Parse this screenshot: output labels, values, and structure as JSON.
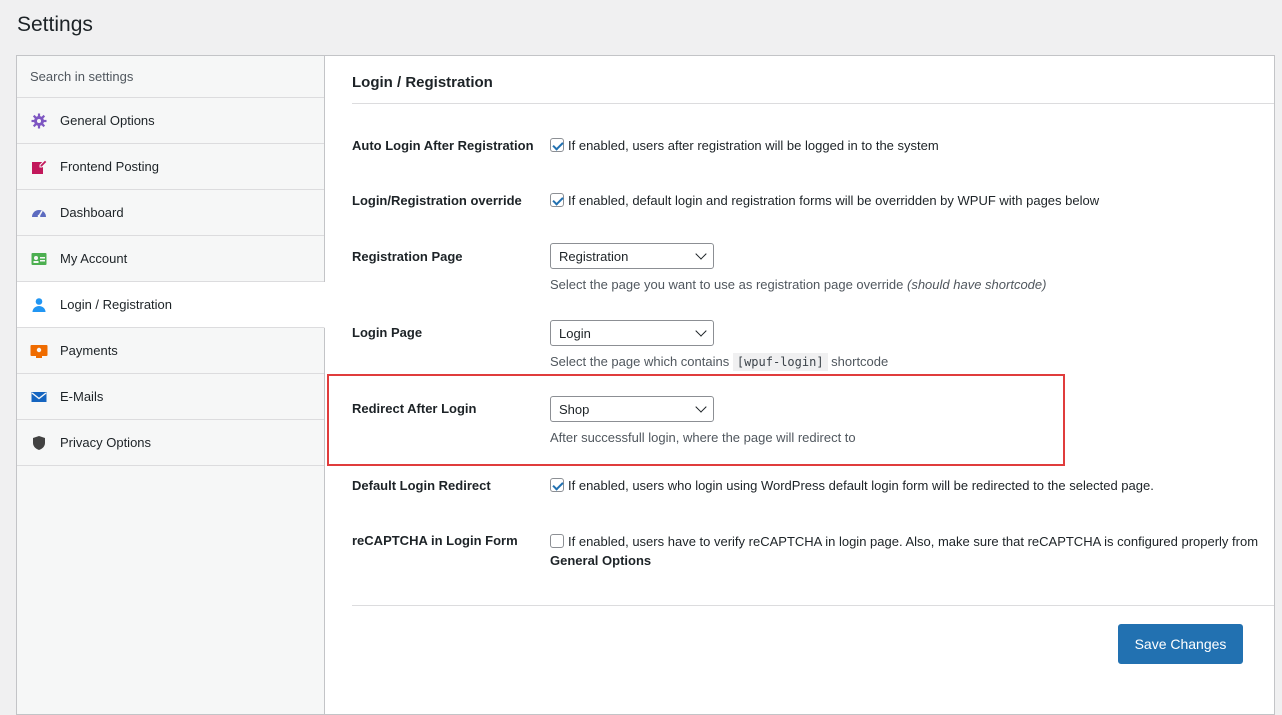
{
  "page": {
    "title": "Settings"
  },
  "sidebar": {
    "search_placeholder": "Search in settings",
    "items": [
      {
        "label": "General Options",
        "icon": "gear-icon",
        "color": "#7e57c2"
      },
      {
        "label": "Frontend Posting",
        "icon": "edit-icon",
        "color": "#c2185b"
      },
      {
        "label": "Dashboard",
        "icon": "dashboard-icon",
        "color": "#5c6bc0"
      },
      {
        "label": "My Account",
        "icon": "id-card-icon",
        "color": "#4caf50"
      },
      {
        "label": "Login / Registration",
        "icon": "user-icon",
        "color": "#2196f3"
      },
      {
        "label": "Payments",
        "icon": "payment-icon",
        "color": "#ef6c00"
      },
      {
        "label": "E-Mails",
        "icon": "mail-icon",
        "color": "#1565c0"
      },
      {
        "label": "Privacy Options",
        "icon": "shield-icon",
        "color": "#424242"
      }
    ]
  },
  "main": {
    "section_title": "Login / Registration",
    "auto_login": {
      "label": "Auto Login After Registration",
      "text": "If enabled, users after registration will be logged in to the system",
      "checked": true
    },
    "override": {
      "label": "Login/Registration override",
      "text": "If enabled, default login and registration forms will be overridden by WPUF with pages below",
      "checked": true
    },
    "registration_page": {
      "label": "Registration Page",
      "value": "Registration",
      "desc_plain": "Select the page you want to use as registration page override ",
      "desc_em": "(should have shortcode)"
    },
    "login_page": {
      "label": "Login Page",
      "value": "Login",
      "desc_pre": "Select the page which contains ",
      "desc_code": "[wpuf-login]",
      "desc_post": " shortcode"
    },
    "redirect_after_login": {
      "label": "Redirect After Login",
      "value": "Shop",
      "desc": "After successfull login, where the page will redirect to"
    },
    "default_login_redirect": {
      "label": "Default Login Redirect",
      "text": "If enabled, users who login using WordPress default login form will be redirected to the selected page.",
      "checked": true
    },
    "recaptcha": {
      "label": "reCAPTCHA in Login Form",
      "text": "If enabled, users have to verify reCAPTCHA in login page. Also, make sure that reCAPTCHA is configured properly from",
      "link": "General Options",
      "checked": false
    },
    "save_label": "Save Changes"
  },
  "colors": {
    "accent": "#2271b1",
    "highlight": "#e03c3c"
  }
}
